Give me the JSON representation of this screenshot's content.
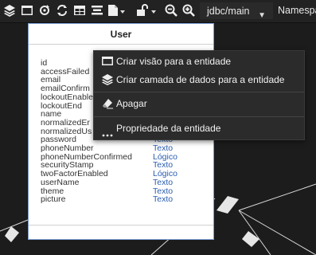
{
  "toolbar": {
    "icons": [
      "layers-icon",
      "window-icon",
      "refresh-db-icon",
      "sync-icon",
      "table-icon",
      "align-icon",
      "new-file-icon",
      "unlock-icon",
      "zoom-out-icon",
      "zoom-in-icon"
    ],
    "database": "jdbc/main",
    "namespace_label": "Namespa"
  },
  "entity": {
    "title": "User",
    "fields": [
      {
        "name": "id",
        "type": ""
      },
      {
        "name": "accessFailed",
        "type": ""
      },
      {
        "name": "email",
        "type": ""
      },
      {
        "name": "emailConfirm",
        "type": ""
      },
      {
        "name": "lockoutEnable",
        "type": ""
      },
      {
        "name": "lockoutEnd",
        "type": ""
      },
      {
        "name": "name",
        "type": ""
      },
      {
        "name": "normalizedEr",
        "type": ""
      },
      {
        "name": "normalizedUs",
        "type": ""
      },
      {
        "name": "password",
        "type": "Texto"
      },
      {
        "name": "phoneNumber",
        "type": "Texto"
      },
      {
        "name": "phoneNumberConfirmed",
        "type": "Lógico"
      },
      {
        "name": "securityStamp",
        "type": "Texto"
      },
      {
        "name": "twoFactorEnabled",
        "type": "Lógico"
      },
      {
        "name": "userName",
        "type": "Texto"
      },
      {
        "name": "theme",
        "type": "Texto"
      },
      {
        "name": "picture",
        "type": "Texto"
      }
    ]
  },
  "context_menu": {
    "items": [
      {
        "label": "Criar visão para a entidade",
        "icon": "window-icon"
      },
      {
        "label": "Criar camada de dados para a entidade",
        "icon": "layers-icon"
      },
      {
        "label": "Apagar",
        "icon": "eraser-icon"
      },
      {
        "label": "Propriedade da entidade",
        "icon": "ellipsis-icon"
      }
    ]
  },
  "colors": {
    "background": "#1c1c1c",
    "menu": "#2b2b2b",
    "type_text": "#2a5db0",
    "card_border": "#7a9cd6"
  }
}
